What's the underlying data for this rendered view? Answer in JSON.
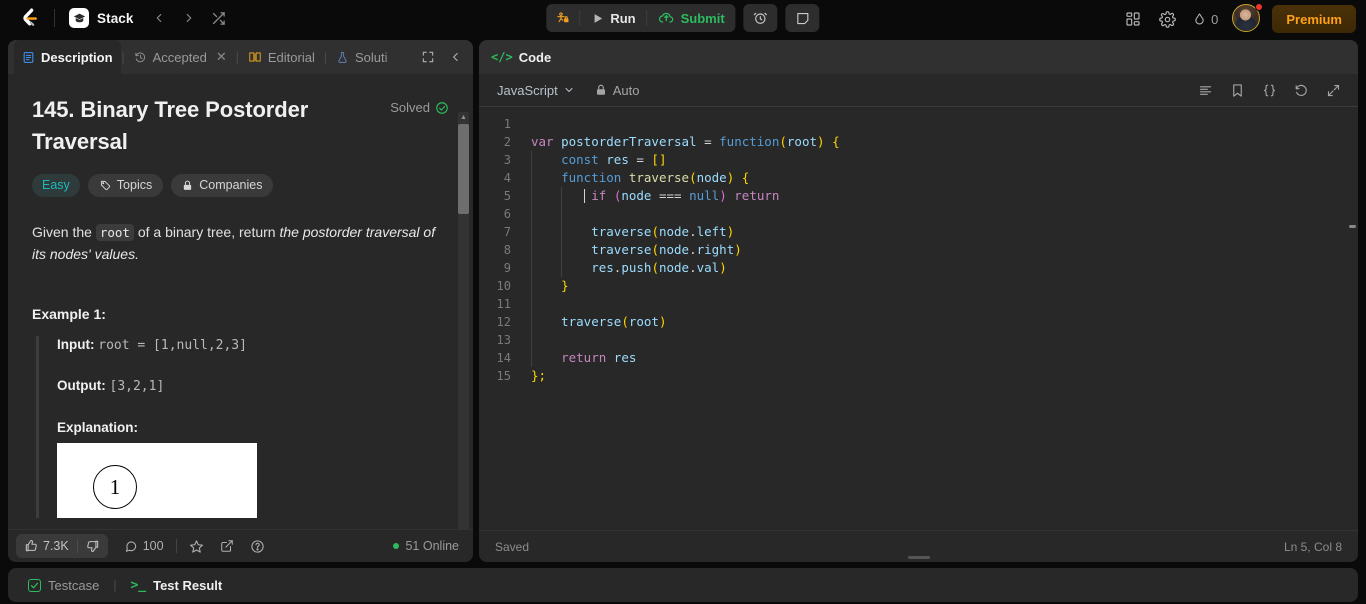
{
  "topnav": {
    "logo_name": "leetcode-logo",
    "stack": {
      "label": "Stack",
      "icon": "graduation-cap-icon"
    },
    "back_icon": "chevron-left-icon",
    "forward_icon": "chevron-right-icon",
    "shuffle_icon": "shuffle-icon",
    "tools": {
      "debug_label": "",
      "debug_icon": "bug-lock-icon",
      "run_label": "Run",
      "run_icon": "play-icon",
      "submit_label": "Submit",
      "submit_icon": "cloud-upload-icon",
      "timer_icon": "alarm-clock-icon",
      "note_icon": "note-icon"
    },
    "right": {
      "apps_icon": "grid-apps-icon",
      "settings_icon": "gear-icon",
      "streak_icon": "flame-icon",
      "streak_count": "0",
      "avatar_name": "user-avatar",
      "notification_dot": true,
      "premium_label": "Premium",
      "premium_color": "#ffa116"
    }
  },
  "left_panel": {
    "tabs": [
      {
        "label": "Description",
        "icon": "document-icon",
        "active": true,
        "closable": false
      },
      {
        "label": "Accepted",
        "icon": "history-icon",
        "active": false,
        "closable": true
      },
      {
        "label": "Editorial",
        "icon": "book-icon",
        "active": false,
        "closable": false
      },
      {
        "label": "Soluti",
        "icon": "flask-icon",
        "active": false,
        "closable": false
      }
    ],
    "expand_icon": "fullscreen-icon",
    "collapse_icon": "chevron-left-icon",
    "question": {
      "title": "145. Binary Tree Postorder Traversal",
      "status_label": "Solved",
      "status_icon": "check-circle-icon",
      "chips": [
        {
          "label": "Easy",
          "kind": "difficulty",
          "color": "#1cbaba"
        },
        {
          "label": "Topics",
          "icon": "tag-icon"
        },
        {
          "label": "Companies",
          "icon": "lock-icon"
        }
      ],
      "statement_pre": "Given the ",
      "statement_code": "root",
      "statement_mid": " of a binary tree, return ",
      "statement_em": "the postorder traversal of its nodes' values.",
      "example_heading": "Example 1:",
      "example_input_label": "Input:",
      "example_input_value": "root = [1,null,2,3]",
      "example_output_label": "Output:",
      "example_output_value": "[3,2,1]",
      "example_explanation_label": "Explanation:",
      "example_image_node": "1"
    },
    "footer": {
      "upvote_icon": "thumbs-up-icon",
      "upvote_count": "7.3K",
      "downvote_icon": "thumbs-down-icon",
      "comment_icon": "comment-icon",
      "comment_count": "100",
      "star_icon": "star-icon",
      "share_icon": "share-external-icon",
      "help_icon": "question-circle-icon",
      "online_label": "51 Online",
      "online_color": "#2cbb5d"
    }
  },
  "code_panel": {
    "header_title": "Code",
    "header_icon": "code-brackets-icon",
    "language": "JavaScript",
    "language_chevron": "chevron-down-icon",
    "auto_label": "Auto",
    "auto_icon": "lock-icon",
    "actions": [
      {
        "icon": "format-lines-icon",
        "name": "format-code-button"
      },
      {
        "icon": "bookmark-icon",
        "name": "bookmark-button"
      },
      {
        "icon": "curly-braces-icon",
        "name": "snippets-button"
      },
      {
        "icon": "reset-undo-icon",
        "name": "reset-code-button"
      },
      {
        "icon": "expand-arrows-icon",
        "name": "fullscreen-editor-button"
      }
    ],
    "lines": [
      {
        "n": "1",
        "tokens": []
      },
      {
        "n": "2",
        "indent": 0,
        "tokens": [
          {
            "t": "var ",
            "c": "kw"
          },
          {
            "t": "postorderTraversal",
            "c": "vr"
          },
          {
            "t": " = ",
            "c": "op"
          },
          {
            "t": "function",
            "c": "fnkw"
          },
          {
            "t": "(",
            "c": "punc"
          },
          {
            "t": "root",
            "c": "vr"
          },
          {
            "t": ")",
            "c": "punc"
          },
          {
            "t": " ",
            "c": "op"
          },
          {
            "t": "{",
            "c": "punc"
          }
        ]
      },
      {
        "n": "3",
        "indent": 1,
        "tokens": [
          {
            "t": "    ",
            "c": "op"
          },
          {
            "t": "const ",
            "c": "fnkw"
          },
          {
            "t": "res",
            "c": "vr"
          },
          {
            "t": " = ",
            "c": "op"
          },
          {
            "t": "[]",
            "c": "punc"
          }
        ]
      },
      {
        "n": "4",
        "indent": 1,
        "tokens": [
          {
            "t": "    ",
            "c": "op"
          },
          {
            "t": "function ",
            "c": "fnkw"
          },
          {
            "t": "traverse",
            "c": "fname"
          },
          {
            "t": "(",
            "c": "punc"
          },
          {
            "t": "node",
            "c": "vr"
          },
          {
            "t": ")",
            "c": "punc"
          },
          {
            "t": " ",
            "c": "op"
          },
          {
            "t": "{",
            "c": "punc"
          }
        ]
      },
      {
        "n": "5",
        "indent": 2,
        "tokens": [
          {
            "t": "        ",
            "c": "op"
          },
          {
            "t": "if",
            "c": "kw"
          },
          {
            "t": " ",
            "c": "op"
          },
          {
            "t": "(",
            "c": "punc2"
          },
          {
            "t": "node",
            "c": "vr"
          },
          {
            "t": " === ",
            "c": "op"
          },
          {
            "t": "null",
            "c": "nullv"
          },
          {
            "t": ")",
            "c": "punc2"
          },
          {
            "t": " ",
            "c": "op"
          },
          {
            "t": "return",
            "c": "kw"
          }
        ]
      },
      {
        "n": "6",
        "indent": 2,
        "tokens": []
      },
      {
        "n": "7",
        "indent": 2,
        "tokens": [
          {
            "t": "        ",
            "c": "op"
          },
          {
            "t": "traverse",
            "c": "vr"
          },
          {
            "t": "(",
            "c": "punc"
          },
          {
            "t": "node",
            "c": "vr"
          },
          {
            "t": ".",
            "c": "op"
          },
          {
            "t": "left",
            "c": "vr"
          },
          {
            "t": ")",
            "c": "punc"
          }
        ]
      },
      {
        "n": "8",
        "indent": 2,
        "tokens": [
          {
            "t": "        ",
            "c": "op"
          },
          {
            "t": "traverse",
            "c": "vr"
          },
          {
            "t": "(",
            "c": "punc"
          },
          {
            "t": "node",
            "c": "vr"
          },
          {
            "t": ".",
            "c": "op"
          },
          {
            "t": "right",
            "c": "vr"
          },
          {
            "t": ")",
            "c": "punc"
          }
        ]
      },
      {
        "n": "9",
        "indent": 2,
        "tokens": [
          {
            "t": "        ",
            "c": "op"
          },
          {
            "t": "res",
            "c": "vr"
          },
          {
            "t": ".",
            "c": "op"
          },
          {
            "t": "push",
            "c": "vr"
          },
          {
            "t": "(",
            "c": "punc"
          },
          {
            "t": "node",
            "c": "vr"
          },
          {
            "t": ".",
            "c": "op"
          },
          {
            "t": "val",
            "c": "vr"
          },
          {
            "t": ")",
            "c": "punc"
          }
        ]
      },
      {
        "n": "10",
        "indent": 1,
        "tokens": [
          {
            "t": "    ",
            "c": "op"
          },
          {
            "t": "}",
            "c": "punc"
          }
        ]
      },
      {
        "n": "11",
        "indent": 1,
        "tokens": []
      },
      {
        "n": "12",
        "indent": 1,
        "tokens": [
          {
            "t": "    ",
            "c": "op"
          },
          {
            "t": "traverse",
            "c": "vr"
          },
          {
            "t": "(",
            "c": "punc"
          },
          {
            "t": "root",
            "c": "vr"
          },
          {
            "t": ")",
            "c": "punc"
          }
        ]
      },
      {
        "n": "13",
        "indent": 1,
        "tokens": []
      },
      {
        "n": "14",
        "indent": 1,
        "tokens": [
          {
            "t": "    ",
            "c": "op"
          },
          {
            "t": "return ",
            "c": "kw"
          },
          {
            "t": "res",
            "c": "vr"
          }
        ]
      },
      {
        "n": "15",
        "indent": 0,
        "tokens": [
          {
            "t": "};",
            "c": "punc"
          }
        ]
      }
    ],
    "footer": {
      "saved_label": "Saved",
      "cursor_label": "Ln 5, Col 8"
    }
  },
  "bottom_panel": {
    "tabs": [
      {
        "label": "Testcase",
        "icon": "checkbox-icon",
        "active": false
      },
      {
        "label": "Test Result",
        "icon": "terminal-icon",
        "active": true
      }
    ]
  }
}
